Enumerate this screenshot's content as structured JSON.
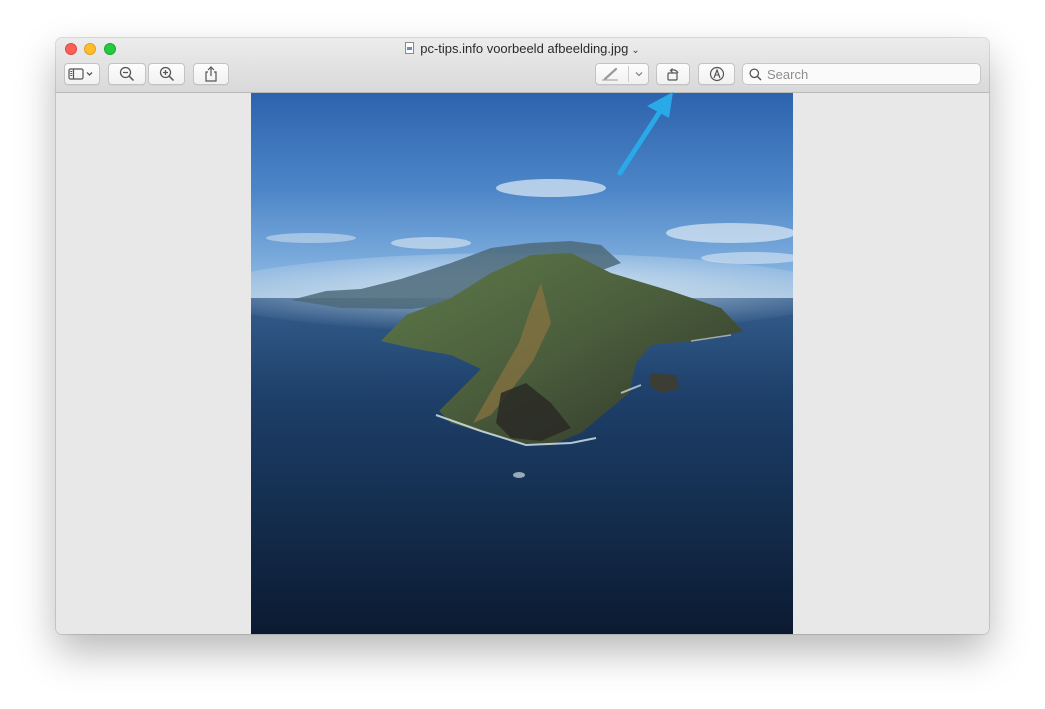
{
  "window": {
    "title": "pc-tips.info voorbeeld afbeelding.jpg",
    "title_chevron": "⌄"
  },
  "toolbar": {
    "sidebar_button": "sidebar-toggle",
    "zoom_out_button": "zoom-out",
    "zoom_in_button": "zoom-in",
    "share_button": "share",
    "markup_pen_button": "pen",
    "rotate_button": "rotate-left",
    "annotate_button": "markup"
  },
  "search": {
    "placeholder": "Search",
    "value": ""
  },
  "colors": {
    "accent_arrow": "#29a9e8",
    "close": "#fe5f57",
    "minimize": "#febc2e",
    "maximize": "#28c840"
  }
}
